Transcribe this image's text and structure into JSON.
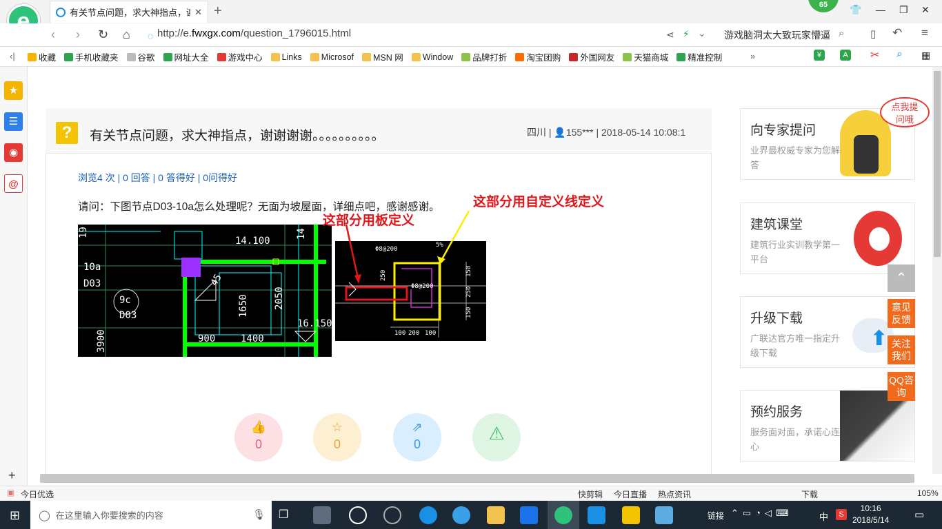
{
  "browser": {
    "tab_title": "有关节点问题，求大神指点，谢谢",
    "new_tab": "+",
    "badge": "65",
    "url_prefix": "http://e.",
    "url_domain": "fwxgx.com",
    "url_path": "/question_1796015.html",
    "search_text": "游戏脑洞太大致玩家懵逼",
    "bookmarks": [
      {
        "label": "收藏",
        "color": "#f5b400"
      },
      {
        "label": "手机收藏夹",
        "color": "#2ea44f"
      },
      {
        "label": "谷歌",
        "color": "#bbbbbb"
      },
      {
        "label": "网址大全",
        "color": "#2ea44f"
      },
      {
        "label": "游戏中心",
        "color": "#e53935"
      },
      {
        "label": "Links",
        "color": "#f2c14e"
      },
      {
        "label": "Microsof",
        "color": "#f2c14e"
      },
      {
        "label": "MSN 网",
        "color": "#f2c14e"
      },
      {
        "label": "Window",
        "color": "#f2c14e"
      },
      {
        "label": "品牌打折",
        "color": "#8bc34a"
      },
      {
        "label": "淘宝团购",
        "color": "#ff6d00"
      },
      {
        "label": "外国网友",
        "color": "#c62828"
      },
      {
        "label": "天猫商城",
        "color": "#8bc34a"
      },
      {
        "label": "精准控制",
        "color": "#2ea44f"
      }
    ],
    "bookmarks_more": "»"
  },
  "question": {
    "title": "有关节点问题，求大神指点，谢谢谢谢。。。。。。。。。。",
    "meta": "四川 | 👤155*** | 2018-05-14 10:08:1",
    "stats": "浏览4 次 | 0 回答 | 0 答得好 | 0问得好",
    "text": "请问：下图节点D03-10a怎么处理呢？无面为坡屋面，详细点吧，感谢感谢。",
    "annotation_board": "这部分用板定义",
    "annotation_line": "这部分用自定义线定义",
    "cad1_labels": [
      "19",
      "14.100",
      "10a",
      "D03",
      "9c",
      "D03",
      "1650",
      "2050",
      "3900",
      "900",
      "1400",
      "16.150",
      "45",
      "14"
    ],
    "cad2_labels": [
      "Φ8@200",
      "Φ8@200",
      "250",
      "150",
      "250",
      "150",
      "100",
      "200",
      "100",
      "5%"
    ],
    "actions": [
      {
        "icon": "thumb-up-icon",
        "count": "0",
        "bg": "#fde0e3",
        "fg": "#e85d75"
      },
      {
        "icon": "star-icon",
        "count": "0",
        "bg": "#fdf0d2",
        "fg": "#e8a735"
      },
      {
        "icon": "share-icon",
        "count": "0",
        "bg": "#d9efff",
        "fg": "#3a97e0"
      },
      {
        "icon": "warning-icon",
        "count": "",
        "bg": "#dff5e3",
        "fg": "#3cbf62"
      }
    ]
  },
  "sidebar_cards": [
    {
      "title": "向专家提问",
      "sub": "业界最权威专家为您解答",
      "bubble": "点我提问哦"
    },
    {
      "title": "建筑课堂",
      "sub": "建筑行业实训教学第一平台"
    },
    {
      "title": "升级下载",
      "sub": "广联达官方唯一指定升级下载"
    },
    {
      "title": "预约服务",
      "sub": "服务面对面，承诺心连心"
    }
  ],
  "float_buttons": [
    "意见反馈",
    "关注我们",
    "QQ咨询"
  ],
  "status_bar": {
    "left": "今日优选",
    "items": [
      "快剪辑",
      "今日直播",
      "热点资讯",
      "下载"
    ],
    "zoom": "105%"
  },
  "taskbar": {
    "search_placeholder": "在这里输入你要搜索的内容",
    "tray_label": "链接",
    "ime": "中",
    "time": "10:16",
    "date": "2018/5/14"
  }
}
